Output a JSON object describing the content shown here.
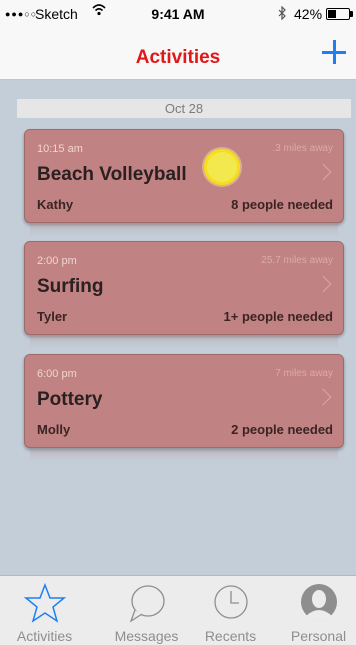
{
  "status_bar": {
    "signal": "●●●○○",
    "carrier": "Sketch",
    "time": "9:41 AM",
    "battery": "42%",
    "battery_level": 0.42
  },
  "nav": {
    "title": "Activities",
    "add_icon": "plus-icon"
  },
  "date_header": "Oct 28",
  "activities": [
    {
      "time": "10:15 am",
      "distance": ".3 miles away",
      "title": "Beach Volleyball",
      "organizer": "Kathy",
      "needed": "8 people needed"
    },
    {
      "time": "2:00 pm",
      "distance": "25.7 miles away",
      "title": "Surfing",
      "organizer": "Tyler",
      "needed": "1+ people needed"
    },
    {
      "time": "6:00 pm",
      "distance": "7 miles away",
      "title": "Pottery",
      "organizer": "Molly",
      "needed": "2 people needed"
    }
  ],
  "tabs": [
    {
      "label": "Activities",
      "icon": "star-icon",
      "active": true
    },
    {
      "label": "Messages",
      "icon": "speech-bubble-icon",
      "active": false
    },
    {
      "label": "Recents",
      "icon": "clock-icon",
      "active": false
    },
    {
      "label": "Personal",
      "icon": "person-icon",
      "active": false
    }
  ],
  "colors": {
    "accent_red": "#e01818",
    "accent_blue": "#1e7ff2",
    "card": "#c08282"
  }
}
